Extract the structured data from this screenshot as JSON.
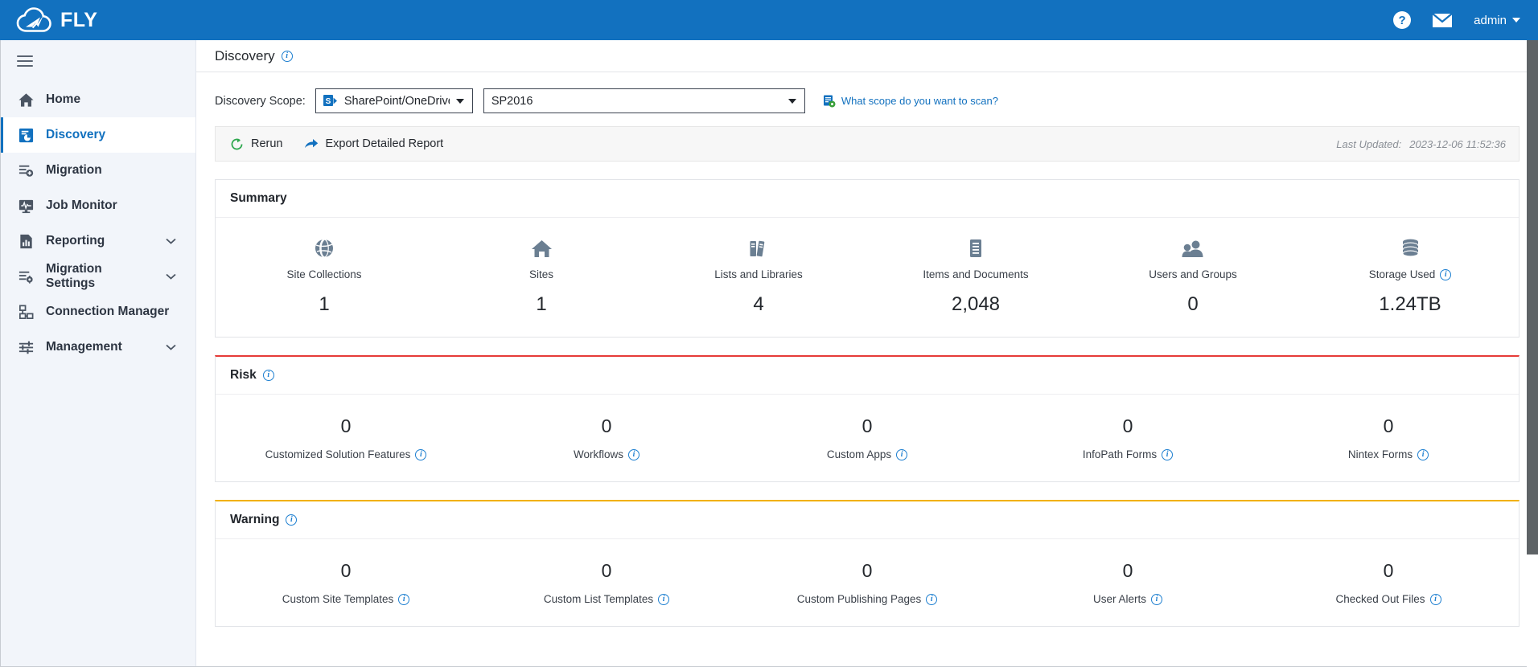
{
  "topbar": {
    "brand": "FLY",
    "logo_icon": "cloud-airplane-logo",
    "help_icon": "help-icon",
    "help_label": "?",
    "mail_icon": "mail-icon",
    "user_label": "admin",
    "brand_color": "#1271bf"
  },
  "sidebar": {
    "menu_toggle_icon": "hamburger-icon",
    "items": [
      {
        "label": "Home",
        "icon": "home-icon",
        "active": false,
        "expandable": false
      },
      {
        "label": "Discovery",
        "icon": "discovery-icon",
        "active": true,
        "expandable": false
      },
      {
        "label": "Migration",
        "icon": "migration-icon",
        "active": false,
        "expandable": false
      },
      {
        "label": "Job Monitor",
        "icon": "job-monitor-icon",
        "active": false,
        "expandable": false
      },
      {
        "label": "Reporting",
        "icon": "reporting-icon",
        "active": false,
        "expandable": true
      },
      {
        "label": "Migration Settings",
        "icon": "migration-settings-icon",
        "active": false,
        "expandable": true
      },
      {
        "label": "Connection Manager",
        "icon": "connection-manager-icon",
        "active": false,
        "expandable": false
      },
      {
        "label": "Management",
        "icon": "management-icon",
        "active": false,
        "expandable": true
      }
    ]
  },
  "page": {
    "title": "Discovery",
    "title_info_icon": "info-icon"
  },
  "scope": {
    "label": "Discovery Scope:",
    "type_value": "SharePoint/OneDrive",
    "type_icon": "sharepoint-icon",
    "name_value": "SP2016",
    "help_link": "What scope do you want to scan?",
    "help_link_icon": "scope-settings-icon",
    "link_color": "#1271bf"
  },
  "toolbar": {
    "rerun_label": "Rerun",
    "rerun_icon": "refresh-icon",
    "export_label": "Export Detailed Report",
    "export_icon": "share-arrow-icon",
    "last_updated_label": "Last Updated:",
    "last_updated_value": "2023-12-06 11:52:36"
  },
  "summary": {
    "title": "Summary",
    "metrics": [
      {
        "icon": "globe-icon",
        "label": "Site Collections",
        "value": "1",
        "info": false
      },
      {
        "icon": "home-filled-icon",
        "label": "Sites",
        "value": "1",
        "info": false
      },
      {
        "icon": "binders-icon",
        "label": "Lists and Libraries",
        "value": "4",
        "info": false
      },
      {
        "icon": "document-icon",
        "label": "Items and Documents",
        "value": "2,048",
        "info": false
      },
      {
        "icon": "users-icon",
        "label": "Users and Groups",
        "value": "0",
        "info": false
      },
      {
        "icon": "database-icon",
        "label": "Storage Used",
        "value": "1.24TB",
        "info": true
      }
    ]
  },
  "risk": {
    "title": "Risk",
    "title_info_icon": "info-icon",
    "accent_color": "#e63b38",
    "metrics": [
      {
        "value": "0",
        "label": "Customized Solution Features",
        "info": true
      },
      {
        "value": "0",
        "label": "Workflows",
        "info": true
      },
      {
        "value": "0",
        "label": "Custom Apps",
        "info": true
      },
      {
        "value": "0",
        "label": "InfoPath Forms",
        "info": true
      },
      {
        "value": "0",
        "label": "Nintex Forms",
        "info": true
      }
    ]
  },
  "warning": {
    "title": "Warning",
    "title_info_icon": "info-icon",
    "accent_color": "#f1b000",
    "metrics": [
      {
        "value": "0",
        "label": "Custom Site Templates",
        "info": true
      },
      {
        "value": "0",
        "label": "Custom List Templates",
        "info": true
      },
      {
        "value": "0",
        "label": "Custom Publishing Pages",
        "info": true
      },
      {
        "value": "0",
        "label": "User Alerts",
        "info": true
      },
      {
        "value": "0",
        "label": "Checked Out Files",
        "info": true
      }
    ]
  }
}
